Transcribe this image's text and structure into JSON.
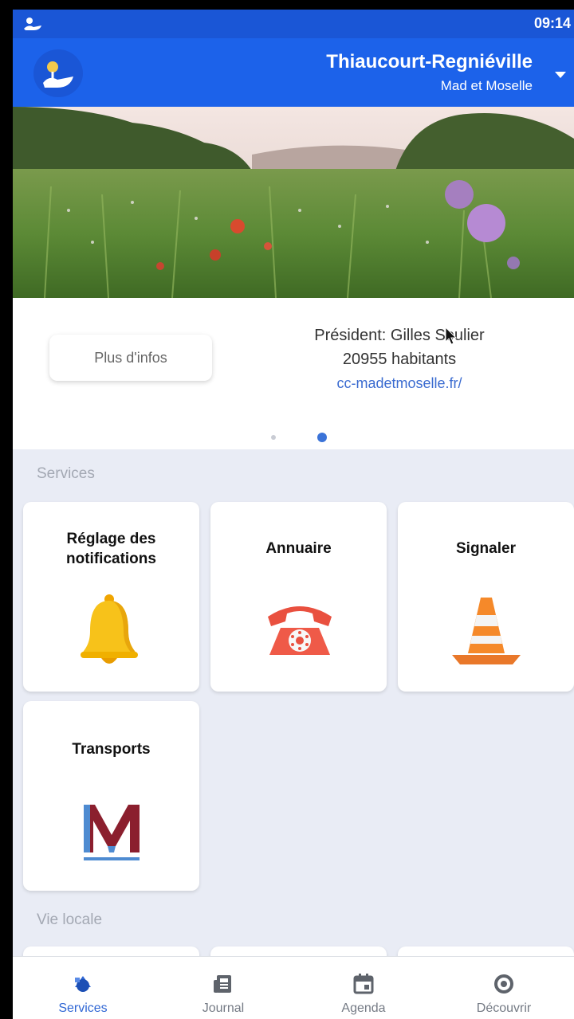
{
  "status_bar": {
    "time": "09:14",
    "app_icon": "app-logo-icon"
  },
  "header": {
    "commune": "Thiaucourt-Regniéville",
    "community": "Mad et Moselle",
    "logo_icon": "app-logo-icon",
    "dropdown_icon": "chevron-down-icon"
  },
  "info_card": {
    "more_button": "Plus d'infos",
    "president": "Président: Gilles Soulier",
    "population": "20955 habitants",
    "website": "cc-madetmoselle.fr/",
    "pagination": {
      "pages": 2,
      "active": 2
    }
  },
  "services": {
    "title": "Services",
    "tiles": [
      {
        "label": "Réglage des notifications",
        "icon": "bell-icon"
      },
      {
        "label": "Annuaire",
        "icon": "telephone-icon"
      },
      {
        "label": "Signaler",
        "icon": "traffic-cone-icon"
      },
      {
        "label": "Transports",
        "icon": "transport-logo-icon"
      }
    ]
  },
  "local": {
    "title": "Vie locale"
  },
  "bottom_nav": {
    "items": [
      {
        "label": "Services",
        "icon": "services-icon",
        "active": true
      },
      {
        "label": "Journal",
        "icon": "newspaper-icon",
        "active": false
      },
      {
        "label": "Agenda",
        "icon": "calendar-icon",
        "active": false
      },
      {
        "label": "Découvrir",
        "icon": "compass-icon",
        "active": false
      }
    ]
  },
  "colors": {
    "header_blue": "#1c62ea",
    "status_blue": "#1a56d6",
    "accent": "#2f66d4",
    "background": "#e9ecf5"
  }
}
